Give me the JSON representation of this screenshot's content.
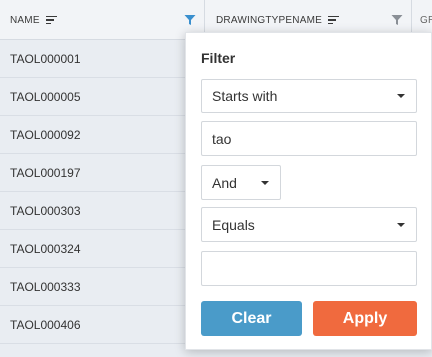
{
  "columns": {
    "name_label": "NAME",
    "type_label": "DRAWINGTYPENAME",
    "extra_label": "GR"
  },
  "rows": [
    "TAOL000001",
    "TAOL000005",
    "TAOL000092",
    "TAOL000197",
    "TAOL000303",
    "TAOL000324",
    "TAOL000333",
    "TAOL000406"
  ],
  "filter": {
    "title": "Filter",
    "condition1_operator": "Starts with",
    "condition1_value": "tao",
    "logic": "And",
    "condition2_operator": "Equals",
    "condition2_value": "",
    "clear_label": "Clear",
    "apply_label": "Apply"
  },
  "colors": {
    "filter_active": "#3a8fce",
    "filter_inactive": "#8a8f96",
    "clear_button": "#4a9bc9",
    "apply_button": "#f06a3e"
  },
  "icons": {
    "sort": "sort-lines-icon",
    "filter": "funnel-icon",
    "dropdown": "caret-down-icon"
  }
}
